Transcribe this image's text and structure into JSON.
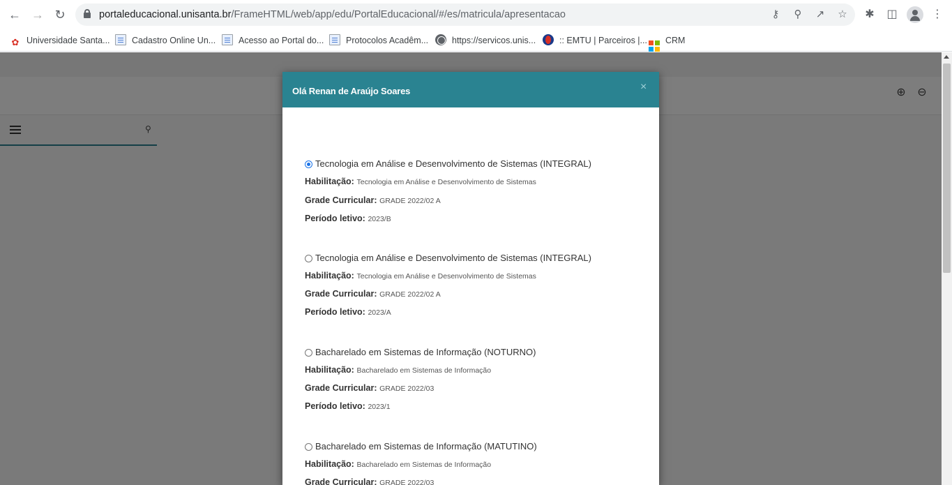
{
  "browser": {
    "url_host": "portaleducacional.unisanta.br",
    "url_path": "/FrameHTML/web/app/edu/PortalEducacional/#/es/matricula/apresentacao"
  },
  "bookmarks": [
    {
      "label": "Universidade Santa...",
      "icon": "unisanta-icon"
    },
    {
      "label": "Cadastro Online Un...",
      "icon": "document-icon"
    },
    {
      "label": "Acesso ao Portal do...",
      "icon": "document-icon"
    },
    {
      "label": "Protocolos Acadêm...",
      "icon": "document-icon"
    },
    {
      "label": "https://servicos.unis...",
      "icon": "globe-icon"
    },
    {
      "label": ":: EMTU | Parceiros |...",
      "icon": "emtu-icon"
    },
    {
      "label": "CRM",
      "icon": "microsoft-icon"
    }
  ],
  "modal": {
    "title": "Olá Renan de Araújo Soares",
    "close_symbol": "×",
    "labels": {
      "habilitacao": "Habilitação:",
      "grade": "Grade Curricular:",
      "periodo": "Período letivo:"
    },
    "options": [
      {
        "title": "Tecnologia em Análise e Desenvolvimento de Sistemas (INTEGRAL)",
        "selected": true,
        "habilitacao": "Tecnologia em Análise e Desenvolvimento de Sistemas",
        "grade": "GRADE 2022/02 A",
        "periodo": "2023/B"
      },
      {
        "title": "Tecnologia em Análise e Desenvolvimento de Sistemas (INTEGRAL)",
        "selected": false,
        "habilitacao": "Tecnologia em Análise e Desenvolvimento de Sistemas",
        "grade": "GRADE 2022/02 A",
        "periodo": "2023/A"
      },
      {
        "title": "Bacharelado em Sistemas de Informação (NOTURNO)",
        "selected": false,
        "habilitacao": "Bacharelado em Sistemas de Informação",
        "grade": "GRADE 2022/03",
        "periodo": "2023/1"
      },
      {
        "title": "Bacharelado em Sistemas de Informação (MATUTINO)",
        "selected": false,
        "habilitacao": "Bacharelado em Sistemas de Informação",
        "grade": "GRADE 2022/03",
        "periodo": ""
      }
    ]
  },
  "colors": {
    "modal_header": "#2a8391",
    "accent_line": "#2a7f8f",
    "radio_selected": "#1a73e8"
  }
}
